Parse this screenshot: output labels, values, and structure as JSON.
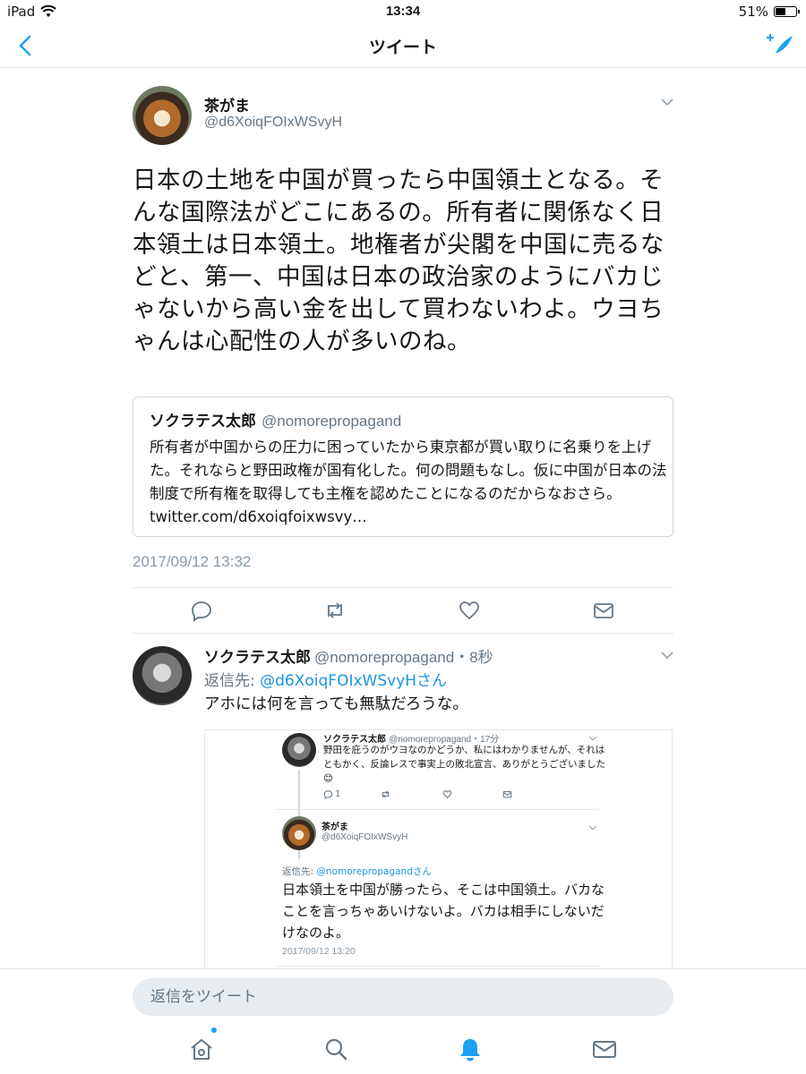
{
  "status_bar": {
    "device": "iPad",
    "time": "13:34",
    "battery_label": "51%",
    "battery_level": 0.51
  },
  "nav": {
    "title": "ツイート"
  },
  "tweet": {
    "author_name": "茶がま",
    "author_handle": "@d6XoiqFOIxWSvyH",
    "text": "日本の土地を中国が買ったら中国領土となる。そんな国際法がどこにあるの。所有者に関係なく日本領土は日本領土。地権者が尖閣を中国に売るなどと、第一、中国は日本の政治家のようにバカじゃないから高い金を出して買わないわよ。ウヨちゃんは心配性の人が多いのね。",
    "timestamp": "2017/09/12 13:32",
    "quote": {
      "name": "ソクラテス太郎",
      "handle": "@nomorepropagand",
      "text": "所有者が中国からの圧力に困っていたから東京都が買い取りに名乗りを上げた。それならと野田政権が国有化した。何の問題もなし。仮に中国が日本の法制度で所有権を取得しても主権を認めたことになるのだからなおさら。 twitter.com/d6xoiqfoixwsvy…"
    }
  },
  "reply": {
    "name": "ソクラテス太郎",
    "meta": "@nomorepropagand・8秒",
    "reply_to_prefix": "返信先: ",
    "reply_to_handle": "@d6XoiqFOIxWSvyHさん",
    "text": "アホには何を言っても無駄だろうな。",
    "screenshot": {
      "tweet1_name": "ソクラテス太郎",
      "tweet1_meta": "@nomorepropagand・17分",
      "tweet1_text": "野田を庇うのがウヨなのかどうか、私にはわかりませんが、それはともかく、反論レスで事実上の敗北宣言、ありがとうございました😊",
      "tweet1_reply_count": "1",
      "tweet2_name": "茶がま",
      "tweet2_handle": "@d6XoiqFOIxWSvyH",
      "tweet2_reply_to_prefix": "返信先: ",
      "tweet2_reply_to_handle": "@nomorepropagandさん",
      "tweet2_text": "日本領土を中国が勝ったら、そこは中国領土。バカなことを言っちゃあいけないよ。バカは相手にしないだけなのよ。",
      "tweet2_time": "2017/09/12 13:20"
    }
  },
  "compose": {
    "placeholder": "返信をツイート"
  },
  "colors": {
    "accent": "#1da1f2",
    "link": "#1b95e0",
    "secondary_text": "#657786"
  },
  "icons": [
    "back-chevron-icon",
    "compose-quill-icon",
    "reply-icon",
    "retweet-icon",
    "like-icon",
    "dm-icon",
    "home-icon",
    "search-icon",
    "notifications-icon",
    "messages-icon"
  ]
}
